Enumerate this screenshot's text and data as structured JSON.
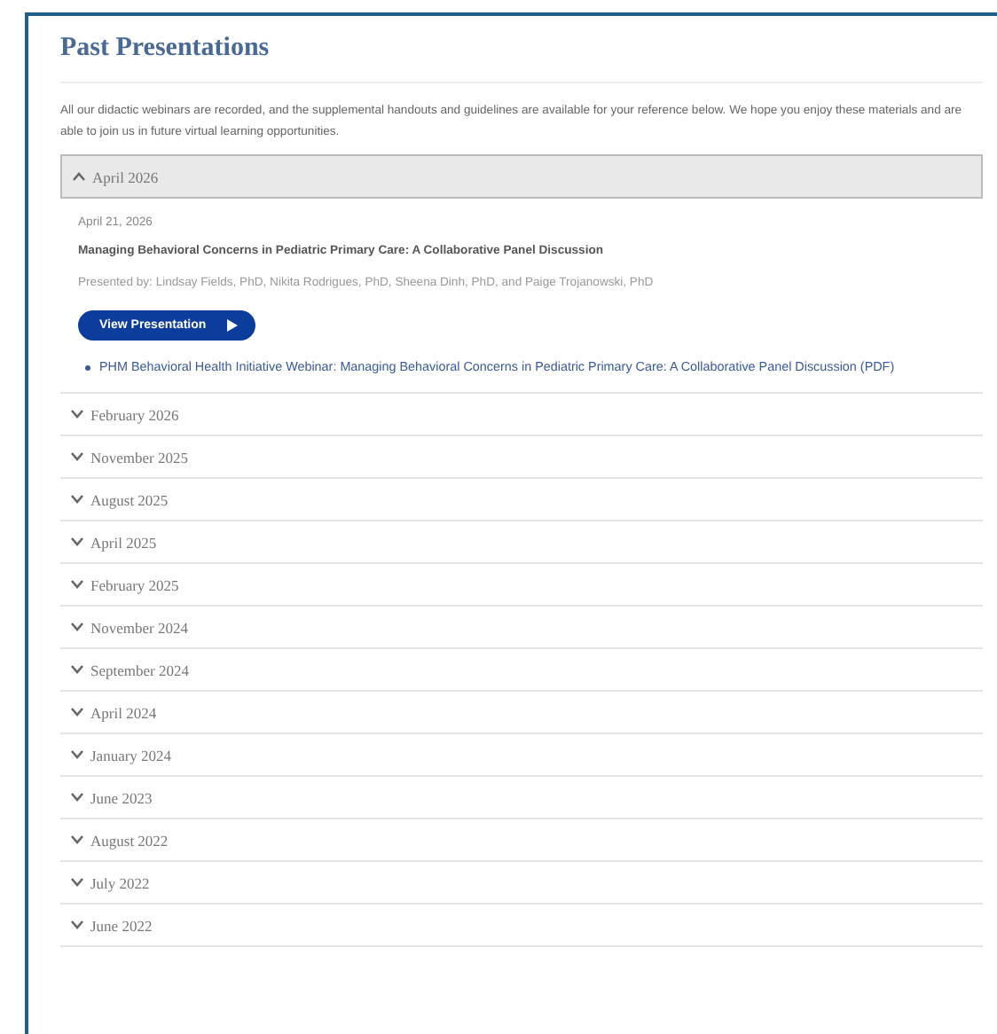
{
  "title": "Past Presentations",
  "intro": "All our didactic webinars are recorded, and the supplemental handouts and guidelines are available for your reference below. We hope you enjoy these materials and are able to join us in future virtual learning opportunities.",
  "sections": [
    {
      "label": "April 2026",
      "expanded": true,
      "date": "April 21, 2026",
      "heading": "Managing Behavioral Concerns in Pediatric Primary Care: A Collaborative Panel Discussion",
      "presenters": "Presented by: Lindsay Fields, PhD, Nikita Rodrigues, PhD, Sheena Dinh, PhD, and Paige Trojanowski, PhD",
      "button": "View Presentation",
      "links": [
        "PHM Behavioral Health Initiative Webinar: Managing Behavioral Concerns in Pediatric Primary Care: A Collaborative Panel Discussion (PDF)"
      ]
    },
    {
      "label": "February 2026",
      "expanded": false
    },
    {
      "label": "November 2025",
      "expanded": false
    },
    {
      "label": "August 2025",
      "expanded": false
    },
    {
      "label": "April 2025",
      "expanded": false
    },
    {
      "label": "February 2025",
      "expanded": false
    },
    {
      "label": "November 2024",
      "expanded": false
    },
    {
      "label": "September 2024",
      "expanded": false
    },
    {
      "label": "April 2024",
      "expanded": false
    },
    {
      "label": "January 2024",
      "expanded": false
    },
    {
      "label": "June 2023",
      "expanded": false
    },
    {
      "label": "August 2022",
      "expanded": false
    },
    {
      "label": "July 2022",
      "expanded": false
    },
    {
      "label": "June 2022",
      "expanded": false
    }
  ]
}
